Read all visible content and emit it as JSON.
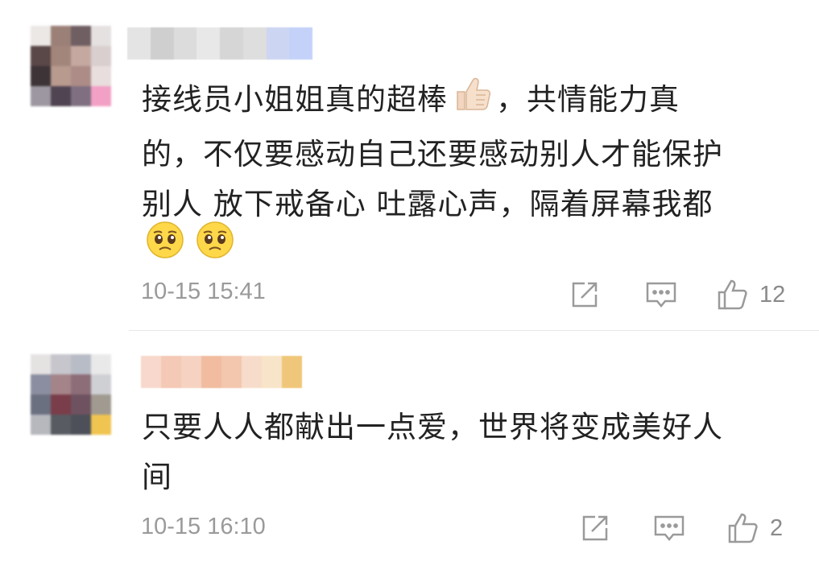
{
  "comments": [
    {
      "text_line1": "接线员小姐姐真的超棒",
      "text_line1b": "，共情能力真",
      "text_line2": "的，不仅要感动自己还要感动别人才能保护",
      "text_line3": "别人 放下戒备心 吐露心声，隔着屏幕我都",
      "time": "10-15 15:41",
      "likes": "12",
      "icons": [
        "thumbs-up-emoji",
        "pleading-face-emoji",
        "pleading-face-emoji",
        "share-icon",
        "comment-icon",
        "like-icon"
      ]
    },
    {
      "text_line1": "只要人人都献出一点爱，世界将变成美好人",
      "text_line2": "间",
      "time": "10-15 16:10",
      "likes": "2",
      "icons": [
        "share-icon",
        "comment-icon",
        "like-icon"
      ]
    }
  ]
}
